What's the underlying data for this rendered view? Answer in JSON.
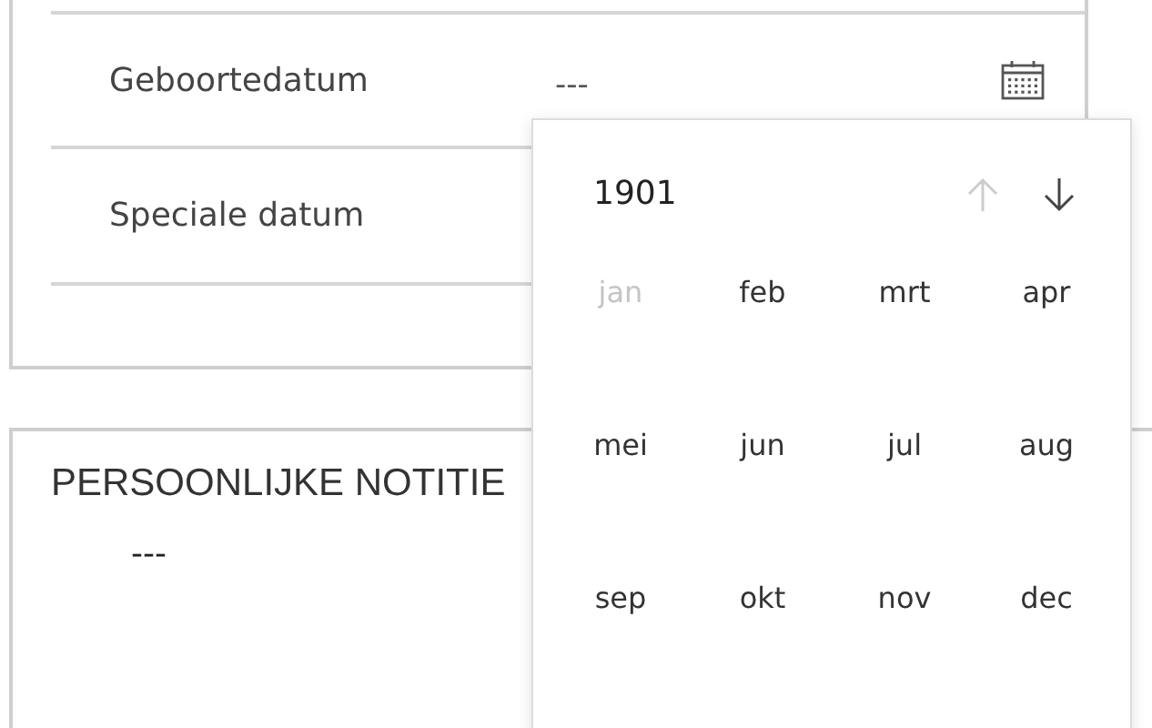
{
  "details_card": {
    "fields": [
      {
        "label": "Geboortedatum",
        "value": "---"
      },
      {
        "label": "Speciale datum"
      }
    ]
  },
  "notes_card": {
    "title": "PERSOONLIJKE NOTITIE",
    "value": "---"
  },
  "month_picker": {
    "year": "1901",
    "previous_disabled": true,
    "next_disabled": false,
    "months": [
      {
        "label": "jan",
        "disabled": true
      },
      {
        "label": "feb",
        "disabled": false
      },
      {
        "label": "mrt",
        "disabled": false
      },
      {
        "label": "apr",
        "disabled": false
      },
      {
        "label": "mei",
        "disabled": false
      },
      {
        "label": "jun",
        "disabled": false
      },
      {
        "label": "jul",
        "disabled": false
      },
      {
        "label": "aug",
        "disabled": false
      },
      {
        "label": "sep",
        "disabled": false
      },
      {
        "label": "okt",
        "disabled": false
      },
      {
        "label": "nov",
        "disabled": false
      },
      {
        "label": "dec",
        "disabled": false
      }
    ]
  }
}
